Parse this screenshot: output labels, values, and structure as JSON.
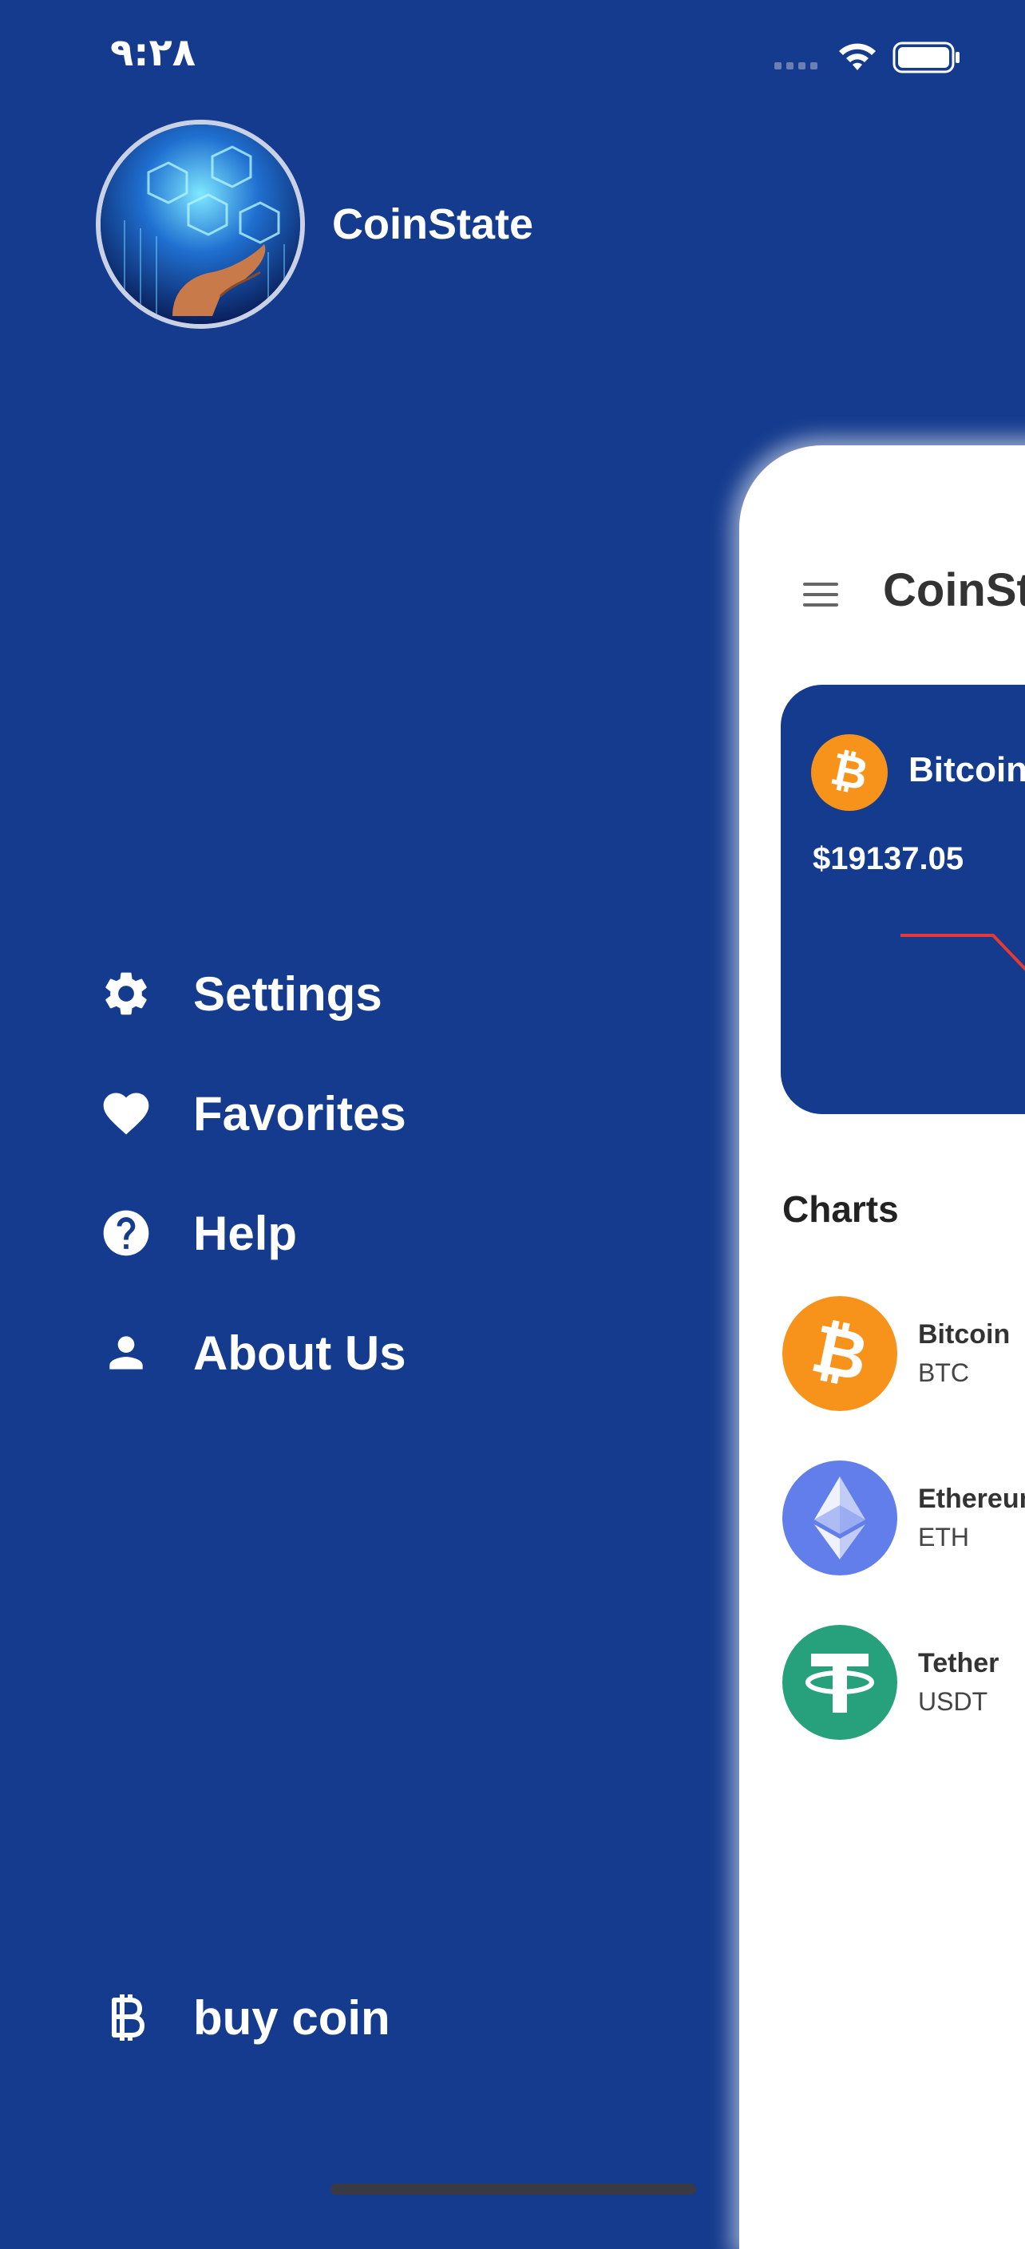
{
  "status_bar": {
    "time": "٩:٢٨"
  },
  "drawer": {
    "brand": "CoinState",
    "items": [
      {
        "label": "Settings",
        "icon": "gear-icon"
      },
      {
        "label": "Favorites",
        "icon": "heart-icon"
      },
      {
        "label": "Help",
        "icon": "help-icon"
      },
      {
        "label": "About Us",
        "icon": "person-icon"
      }
    ],
    "buy": {
      "label": "buy coin",
      "icon": "bitcoin-icon"
    }
  },
  "main": {
    "title": "CoinSt",
    "card": {
      "coin_name": "Bitcoin",
      "price": "$19137.05"
    },
    "charts_heading": "Charts",
    "coins": [
      {
        "name": "Bitcoin",
        "symbol": "BTC",
        "color": "#f7931a",
        "icon": "bitcoin-logo-icon"
      },
      {
        "name": "Ethereum",
        "symbol": "ETH",
        "color": "#627eea",
        "icon": "ethereum-logo-icon"
      },
      {
        "name": "Tether",
        "symbol": "USDT",
        "color": "#26a17b",
        "icon": "tether-logo-icon"
      }
    ]
  },
  "colors": {
    "background": "#143b8e",
    "bitcoin": "#f7931a",
    "ethereum": "#627eea",
    "tether": "#26a17b",
    "sparkline": "#e53935"
  }
}
